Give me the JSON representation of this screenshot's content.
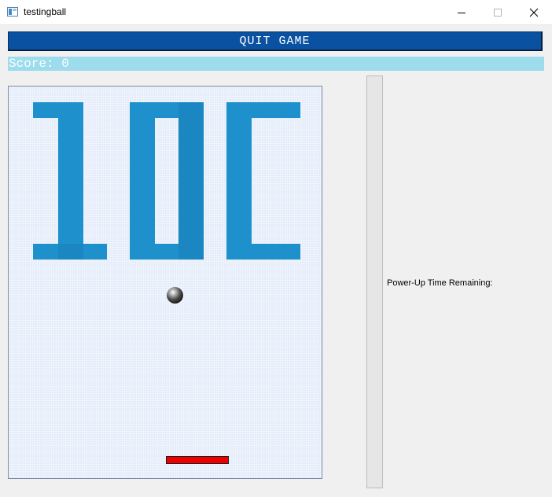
{
  "window": {
    "title": "testingball",
    "icon": "app-window-icon",
    "controls": [
      "minimize-icon",
      "maximize-icon",
      "close-icon"
    ]
  },
  "game": {
    "quit_label": "QUIT GAME",
    "score_label": "Score: 0",
    "score": 0,
    "brick_text": "1DC",
    "powerup_label": "Power-Up Time Remaining:",
    "powerup_progress": 0
  },
  "colors": {
    "quit_button": "#0a52a1",
    "score_bar": "#9cdcec",
    "brick": "#1e90cc",
    "paddle": "#ee0000",
    "field": "#e4ecfa"
  }
}
